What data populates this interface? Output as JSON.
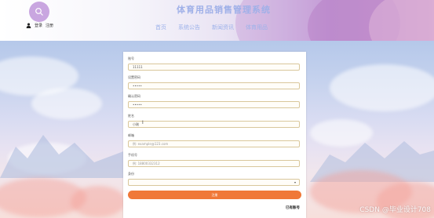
{
  "header": {
    "title": "体育用品销售管理系统",
    "auth": {
      "login": "登录",
      "register": "注册"
    },
    "nav": [
      "首页",
      "系统公告",
      "新闻资讯",
      "体育用品"
    ]
  },
  "form": {
    "fields": [
      {
        "label": "账号",
        "value": "11111",
        "placeholder": ""
      },
      {
        "label": "设置密码",
        "value": "•••••",
        "placeholder": ""
      },
      {
        "label": "确认密码",
        "value": "•••••",
        "placeholder": ""
      },
      {
        "label": "姓名",
        "value": "小刚",
        "placeholder": ""
      },
      {
        "label": "邮箱",
        "value": "",
        "placeholder": "例: example@123.com"
      },
      {
        "label": "手机号",
        "value": "",
        "placeholder": "例: 18800332312"
      },
      {
        "label": "身份",
        "value": "",
        "placeholder": ""
      }
    ],
    "submit_label": "注册",
    "login_link": "已有账号"
  },
  "watermark": "CSDN @毕业设计708",
  "icons": {
    "logo": "search-icon",
    "user": "user-icon",
    "select_caret": "chevron-down-icon"
  },
  "colors": {
    "accent": "#f07838",
    "input_border": "#d9c79b",
    "nav_text": "#9db2ea"
  }
}
